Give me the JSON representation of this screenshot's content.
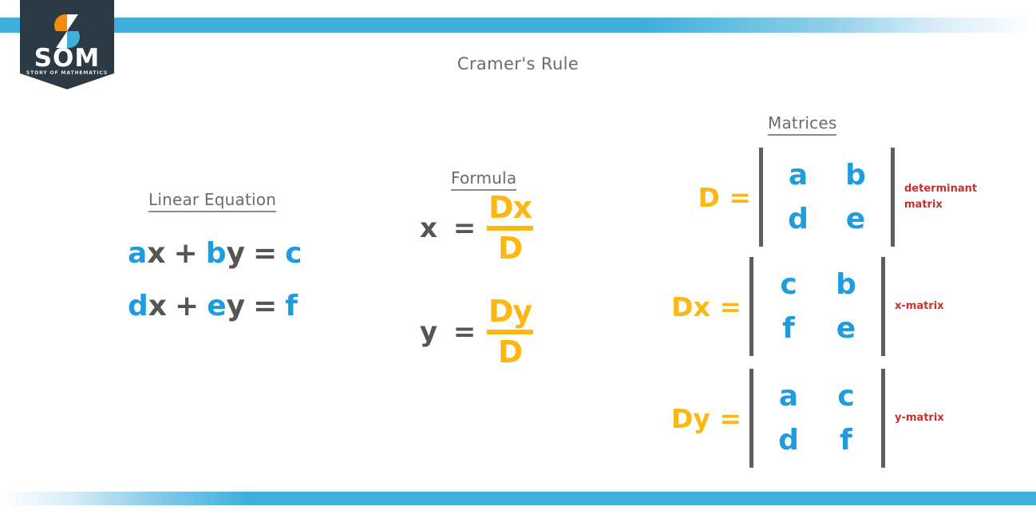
{
  "page": {
    "title": "Cramer's Rule",
    "background": "#ffffff"
  },
  "colors": {
    "coefficient_blue": "#1F9BE0",
    "formula_orange": "#FBB713",
    "annotation_red": "#C9302C",
    "text_gray": "#555555",
    "heading_gray": "#6b6b6b",
    "bracket_gray": "#5e5e5e",
    "bar_blue": "#3FAEDC",
    "badge_navy": "#2B3A44"
  },
  "logo": {
    "wordmark": "SOM",
    "tagline": "STORY OF MATHEMATICS",
    "mark_name": "som-s-monogram"
  },
  "linear_equation": {
    "heading": "Linear Equation",
    "equations": [
      {
        "coef1": "a",
        "var1": "x",
        "operator": "+",
        "coef2": "b",
        "var2": "y",
        "equals": "=",
        "constant": "c"
      },
      {
        "coef1": "d",
        "var1": "x",
        "operator": "+",
        "coef2": "e",
        "var2": "y",
        "equals": "=",
        "constant": "f"
      }
    ]
  },
  "formula": {
    "heading": "Formula",
    "rows": [
      {
        "variable": "x",
        "equals": "=",
        "numerator": "Dx",
        "denominator": "D"
      },
      {
        "variable": "y",
        "equals": "=",
        "numerator": "Dy",
        "denominator": "D"
      }
    ]
  },
  "matrices": {
    "heading": "Matrices",
    "items": [
      {
        "label": "D =",
        "cells": [
          "a",
          "b",
          "d",
          "e"
        ],
        "note": "determinant matrix"
      },
      {
        "label": "Dx =",
        "cells": [
          "c",
          "b",
          "f",
          "e"
        ],
        "note": "x-matrix"
      },
      {
        "label": "Dy =",
        "cells": [
          "a",
          "c",
          "d",
          "f"
        ],
        "note": "y-matrix"
      }
    ]
  }
}
